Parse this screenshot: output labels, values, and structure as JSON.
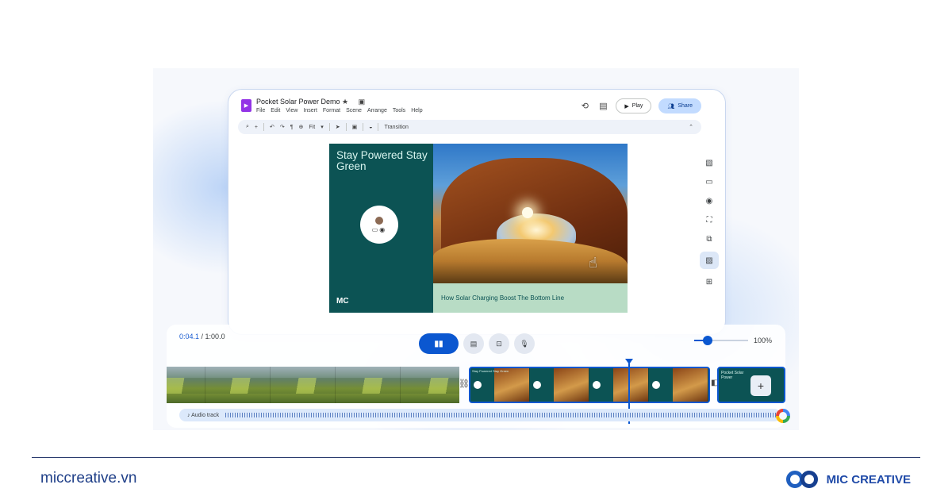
{
  "app": {
    "title": "Pocket Solar Power Demo",
    "title_icons": "★ ▣",
    "menu": [
      "File",
      "Edit",
      "View",
      "Insert",
      "Format",
      "Scene",
      "Arrange",
      "Tools",
      "Help"
    ],
    "play_label": "Play",
    "share_label": "Share",
    "toolbar": {
      "zoom_fit": "Fit",
      "transition_label": "Transition"
    }
  },
  "slide": {
    "title": "Stay Powered Stay Green",
    "caption": "How Solar Charging Boost The Bottom Line",
    "logo_text": "MC"
  },
  "timeline": {
    "current_time": "0:04.1",
    "total_time": "/ 1:00.0",
    "zoom_label": "100%",
    "zoom_fraction": 0.25,
    "clip_b_thumb_title": "Stay Powered Stay Green",
    "clip_c_title": "Pocket Solar Power",
    "add_label": "+",
    "audio_label": "Audio track"
  },
  "footer": {
    "website": "miccreative.vn",
    "brand": "MIC CREATIVE"
  },
  "colors": {
    "accent_blue": "#0b57d0",
    "slide_teal": "#0c5354",
    "caption_green": "#b8dcc5",
    "brand_blue": "#1f4aa8"
  }
}
